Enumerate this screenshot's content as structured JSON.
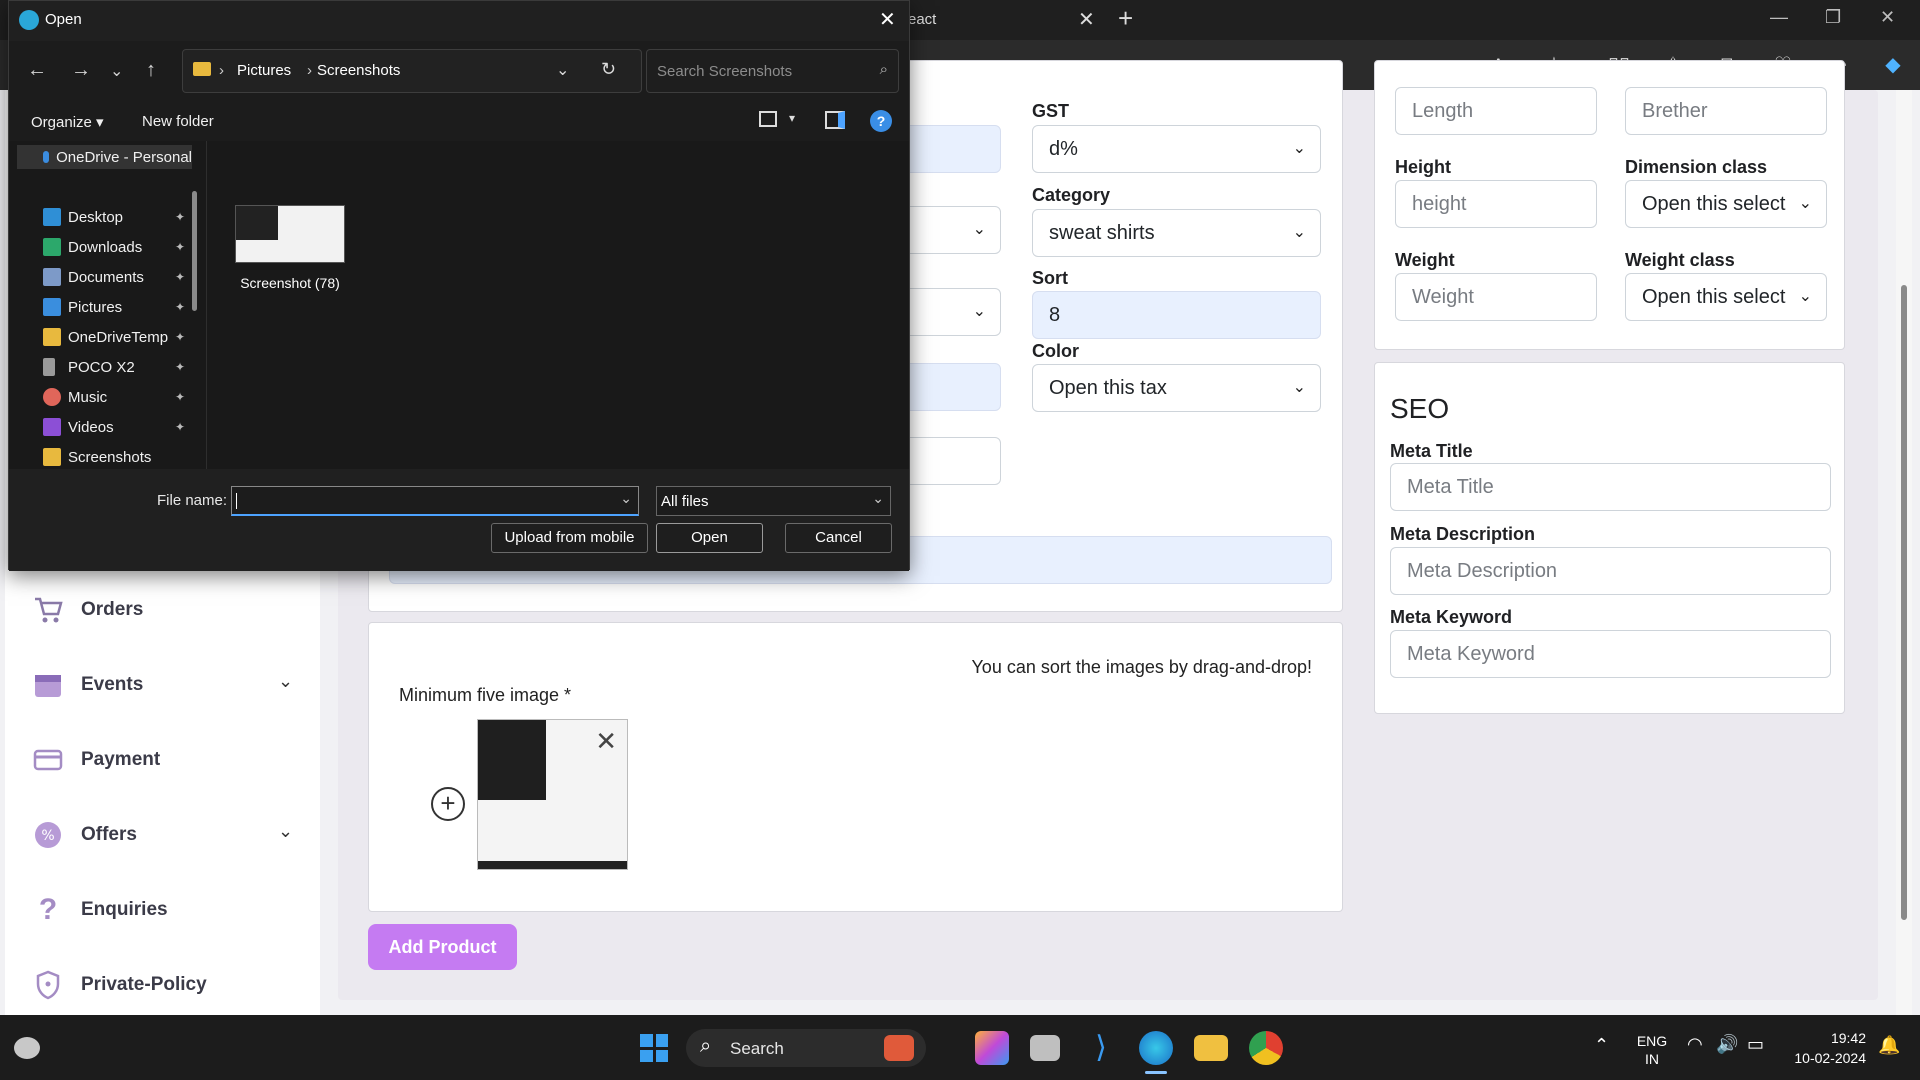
{
  "browser": {
    "tab_title": "eact",
    "tab_close": "✕",
    "new_tab": "+"
  },
  "sidebar": {
    "items": [
      {
        "label": "Orders",
        "icon": "cart-icon",
        "has_chevron": false
      },
      {
        "label": "Events",
        "icon": "calendar-icon",
        "has_chevron": true
      },
      {
        "label": "Payment",
        "icon": "card-icon",
        "has_chevron": false
      },
      {
        "label": "Offers",
        "icon": "badge-icon",
        "has_chevron": true
      },
      {
        "label": "Enquiries",
        "icon": "question-icon",
        "has_chevron": false
      },
      {
        "label": "Private-Policy",
        "icon": "shield-icon",
        "has_chevron": false
      }
    ]
  },
  "form": {
    "gst_label": "GST",
    "gst_value": "d%",
    "category_label": "Category",
    "category_value": "sweat shirts",
    "sort_label": "Sort",
    "sort_value": "8",
    "color_label": "Color",
    "color_value": "Open this tax"
  },
  "dimensions": {
    "length_placeholder": "Length",
    "breadth_placeholder": "Brether",
    "height_label": "Height",
    "height_placeholder": "height",
    "dimension_class_label": "Dimension class",
    "dimension_class_value": "Open this select",
    "weight_label": "Weight",
    "weight_placeholder": "Weight",
    "weight_class_label": "Weight class",
    "weight_class_value": "Open this select"
  },
  "seo": {
    "title": "SEO",
    "meta_title_label": "Meta Title",
    "meta_title_placeholder": "Meta Title",
    "meta_description_label": "Meta Description",
    "meta_description_placeholder": "Meta Description",
    "meta_keyword_label": "Meta Keyword",
    "meta_keyword_placeholder": "Meta Keyword"
  },
  "images": {
    "hint": "You can sort the images by drag-and-drop!",
    "label": "Minimum five image *"
  },
  "add_product_label": "Add Product",
  "dialog": {
    "title": "Open",
    "path": [
      "Pictures",
      "Screenshots"
    ],
    "search_placeholder": "Search Screenshots",
    "organize_label": "Organize",
    "new_folder_label": "New folder",
    "nav_items": [
      {
        "label": "OneDrive - Personal",
        "icon": "cloud-icon",
        "color": "#3b8de0"
      },
      {
        "label": "Desktop",
        "icon": "desktop-icon",
        "color": "#2f8fd6"
      },
      {
        "label": "Downloads",
        "icon": "download-icon",
        "color": "#2ca86b"
      },
      {
        "label": "Documents",
        "icon": "document-icon",
        "color": "#7d9ac8"
      },
      {
        "label": "Pictures",
        "icon": "pictures-icon",
        "color": "#3a8ede"
      },
      {
        "label": "OneDriveTemp",
        "icon": "folder-icon",
        "color": "#e8b93e"
      },
      {
        "label": "POCO X2",
        "icon": "phone-icon",
        "color": "#9a9a9a"
      },
      {
        "label": "Music",
        "icon": "music-icon",
        "color": "#e0665a"
      },
      {
        "label": "Videos",
        "icon": "video-icon",
        "color": "#8c4fd6"
      },
      {
        "label": "Screenshots",
        "icon": "folder-icon",
        "color": "#e8b93e"
      }
    ],
    "file_name": "Screenshot (78)",
    "file_name_label": "File name:",
    "file_name_value": "",
    "filter_value": "All files",
    "upload_mobile_label": "Upload from mobile",
    "open_label": "Open",
    "cancel_label": "Cancel"
  },
  "taskbar": {
    "search_label": "Search",
    "lang_line1": "ENG",
    "lang_line2": "IN",
    "time": "19:42",
    "date": "10-02-2024"
  },
  "colors": {
    "accent_purple": "#c57bf2",
    "input_autofill": "#e8f0fe"
  }
}
